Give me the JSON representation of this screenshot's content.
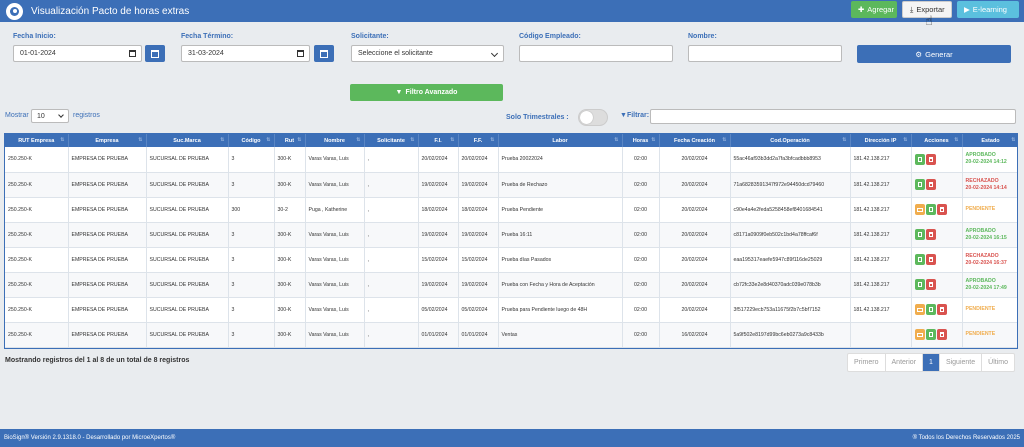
{
  "header": {
    "title": "Visualización Pacto de horas extras",
    "add_label": "Agregar",
    "export_label": "Exportar",
    "elearning_label": "E-learning"
  },
  "filters": {
    "start_label": "Fecha Inicio:",
    "start_value": "01-01-2024",
    "end_label": "Fecha Término:",
    "end_value": "31-03-2024",
    "requester_label": "Solicitante:",
    "requester_value": "Seleccione el solicitante",
    "employee_code_label": "Código Empleado:",
    "name_label": "Nombre:",
    "generate_label": "Generar",
    "advanced_label": "Filtro Avanzado"
  },
  "controls": {
    "show_label": "Mostrar",
    "page_length": "10",
    "records_label": "registros",
    "quarterly_label": "Solo Trimestrales :",
    "filter_label": "Filtrar:"
  },
  "table": {
    "columns": [
      "RUT Empresa",
      "Empresa",
      "Suc.Marca",
      "Código",
      "Rut",
      "Nombre",
      "Solicitante",
      "F.I.",
      "F.F.",
      "Labor",
      "Horas",
      "Fecha Creación",
      "Cod.Operación",
      "Dirección IP",
      "Acciones",
      "Estado"
    ],
    "rows": [
      {
        "rut_empresa": "250.250-K",
        "empresa": "EMPRESA DE PRUEBA",
        "suc": "SUCURSAL DE PRUEBA",
        "codigo": "3",
        "rut": "300-K",
        "nombre": "Varas Varas, Luis",
        "solicitante": ",",
        "fi": "20/02/2024",
        "ff": "20/02/2024",
        "labor": "Prueba 20022024",
        "horas": "02:00",
        "creacion": "20/02/2024",
        "codop": "55ac46af93b3dd2a7fa3bfcadbbb8953",
        "ip": "181.42.138.217",
        "estado": "APROBADO",
        "estado_fecha": "20-02-2024 14:12",
        "estado_color": "#5cb85c",
        "acciones": [
          "pdf",
          "del"
        ]
      },
      {
        "rut_empresa": "250.250-K",
        "empresa": "EMPRESA DE PRUEBA",
        "suc": "SUCURSAL DE PRUEBA",
        "codigo": "3",
        "rut": "300-K",
        "nombre": "Varas Varas, Luis",
        "solicitante": ",",
        "fi": "19/02/2024",
        "ff": "19/02/2024",
        "labor": "Prueba de Rechazo",
        "horas": "02:00",
        "creacion": "20/02/2024",
        "codop": "71a68283591347f972e94450dcd79460",
        "ip": "181.42.138.217",
        "estado": "RECHAZADO",
        "estado_fecha": "20-02-2024 14:14",
        "estado_color": "#d9534f",
        "acciones": [
          "pdf",
          "del"
        ]
      },
      {
        "rut_empresa": "250.250-K",
        "empresa": "EMPRESA DE PRUEBA",
        "suc": "SUCURSAL DE PRUEBA",
        "codigo": "300",
        "rut": "30-2",
        "nombre": "Puga , Katherine",
        "solicitante": ",",
        "fi": "18/02/2024",
        "ff": "18/02/2024",
        "labor": "Prueba Pendiente",
        "horas": "02:00",
        "creacion": "20/02/2024",
        "codop": "c90e4a4e2feda5258458ef8401684541",
        "ip": "181.42.138.217",
        "estado": "PENDIENTE",
        "estado_fecha": "",
        "estado_color": "#f0ad4e",
        "acciones": [
          "mail",
          "pdf",
          "del"
        ]
      },
      {
        "rut_empresa": "250.250-K",
        "empresa": "EMPRESA DE PRUEBA",
        "suc": "SUCURSAL DE PRUEBA",
        "codigo": "3",
        "rut": "300-K",
        "nombre": "Varas Varas, Luis",
        "solicitante": ",",
        "fi": "19/02/2024",
        "ff": "19/02/2024",
        "labor": "Prueba 16:11",
        "horas": "02:00",
        "creacion": "20/02/2024",
        "codop": "c8171a0909f0eb502c1bd4a78ffcaf6f",
        "ip": "181.42.138.217",
        "estado": "APROBADO",
        "estado_fecha": "20-02-2024 16:15",
        "estado_color": "#5cb85c",
        "acciones": [
          "pdf",
          "del"
        ]
      },
      {
        "rut_empresa": "250.250-K",
        "empresa": "EMPRESA DE PRUEBA",
        "suc": "SUCURSAL DE PRUEBA",
        "codigo": "3",
        "rut": "300-K",
        "nombre": "Varas Varas, Luis",
        "solicitante": ",",
        "fi": "15/02/2024",
        "ff": "15/02/2024",
        "labor": "Prueba días Pasados",
        "horas": "02:00",
        "creacion": "20/02/2024",
        "codop": "eaa195317eaefe5947c89f116de25029",
        "ip": "181.42.138.217",
        "estado": "RECHAZADO",
        "estado_fecha": "20-02-2024 16:37",
        "estado_color": "#d9534f",
        "acciones": [
          "pdf",
          "del"
        ]
      },
      {
        "rut_empresa": "250.250-K",
        "empresa": "EMPRESA DE PRUEBA",
        "suc": "SUCURSAL DE PRUEBA",
        "codigo": "3",
        "rut": "300-K",
        "nombre": "Varas Varas, Luis",
        "solicitante": ",",
        "fi": "19/02/2024",
        "ff": "19/02/2024",
        "labor": "Prueba con Fecha y Hora de Aceptación",
        "horas": "02:00",
        "creacion": "20/02/2024",
        "codop": "cb72fc33e2e8d40370adc039e078b3b",
        "ip": "181.42.138.217",
        "estado": "APROBADO",
        "estado_fecha": "20-02-2024 17:49",
        "estado_color": "#5cb85c",
        "acciones": [
          "pdf",
          "del"
        ]
      },
      {
        "rut_empresa": "250.250-K",
        "empresa": "EMPRESA DE PRUEBA",
        "suc": "SUCURSAL DE PRUEBA",
        "codigo": "3",
        "rut": "300-K",
        "nombre": "Varas Varas, Luis",
        "solicitante": ",",
        "fi": "05/02/2024",
        "ff": "05/02/2024",
        "labor": "Prueba para Pendiente luego de 48H",
        "horas": "02:00",
        "creacion": "20/02/2024",
        "codop": "3f517229ecb753a11675f2b7c5bf7152",
        "ip": "181.42.138.217",
        "estado": "PENDIENTE",
        "estado_fecha": "",
        "estado_color": "#f0ad4e",
        "acciones": [
          "mail",
          "pdf",
          "del"
        ]
      },
      {
        "rut_empresa": "250.250-K",
        "empresa": "EMPRESA DE PRUEBA",
        "suc": "SUCURSAL DE PRUEBA",
        "codigo": "3",
        "rut": "300-K",
        "nombre": "Varas Varas, Luis",
        "solicitante": ",",
        "fi": "01/01/2024",
        "ff": "01/01/2024",
        "labor": "Ventas",
        "horas": "02:00",
        "creacion": "16/02/2024",
        "codop": "5a9f502e8197d99bc6eb0273a9c8433b",
        "ip": "",
        "estado": "PENDIENTE",
        "estado_fecha": "",
        "estado_color": "#f0ad4e",
        "acciones": [
          "mail",
          "pdf",
          "del"
        ]
      }
    ]
  },
  "info": "Mostrando registros del 1 al 8 de un total de 8 registros",
  "pager": {
    "first": "Primero",
    "prev": "Anterior",
    "current": "1",
    "next": "Siguiente",
    "last": "Último"
  },
  "footer": {
    "left": "BioSign® Versión 2.9.1318.0 - Desarrollado por MicroeXpertos®",
    "right": "® Todos los Derechos Reservados 2025"
  },
  "icons": {
    "app": "biosign-logo",
    "add": "plus-icon",
    "export": "download-icon",
    "elearning": "video-icon",
    "calendar": "calendar-icon",
    "generate": "gears-icon",
    "filter": "filter-icon",
    "pdf": "file-pdf-icon",
    "delete": "trash-icon",
    "mail": "envelope-icon"
  },
  "colors": {
    "primary": "#3c6fb7",
    "success": "#5cb85c",
    "danger": "#d9534f",
    "warning": "#f0ad4e",
    "info": "#5bc0de"
  }
}
